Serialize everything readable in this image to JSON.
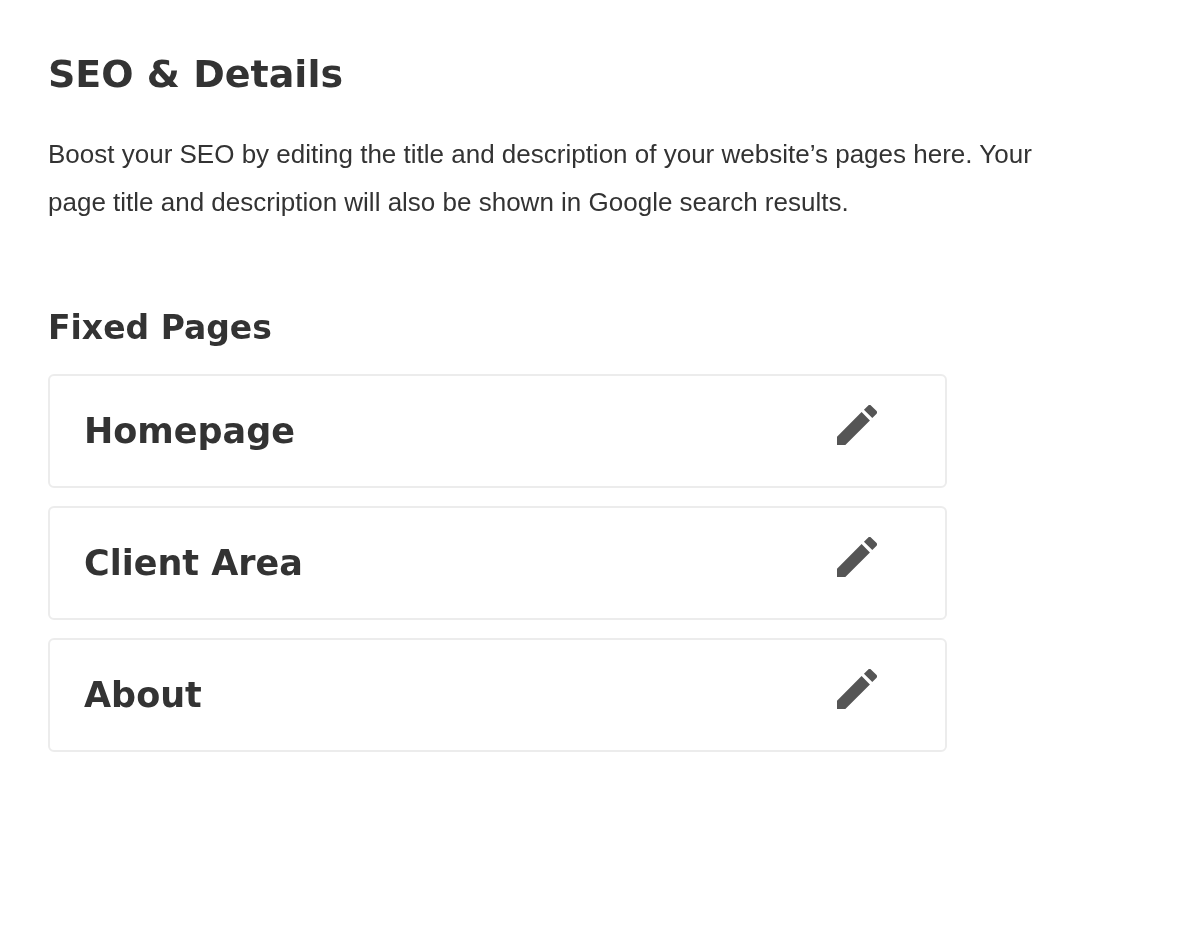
{
  "title": "SEO & Details",
  "description": "Boost your SEO by editing the title and description of your website’s pages here. Your page title and description will also be shown in Google search results.",
  "section": {
    "heading": "Fixed Pages",
    "pages": [
      {
        "label": "Homepage"
      },
      {
        "label": "Client Area"
      },
      {
        "label": "About"
      }
    ]
  }
}
